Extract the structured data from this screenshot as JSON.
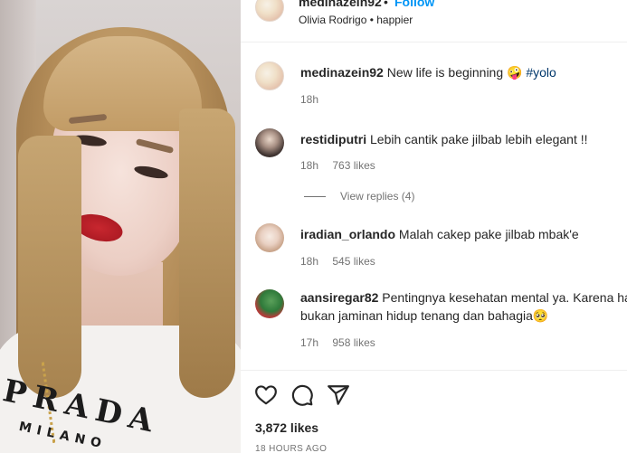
{
  "header": {
    "username": "medinazein92",
    "separator": "•",
    "follow_label": "Follow",
    "audio": "Olivia Rodrigo • happier"
  },
  "caption": {
    "username": "medinazein92",
    "text": "New life is beginning 🤪",
    "hashtag": "#yolo",
    "time": "18h"
  },
  "comments": [
    {
      "username": "restidiputri",
      "text": "Lebih cantik pake jilbab lebih elegant !!",
      "time": "18h",
      "likes": "763 likes"
    },
    {
      "username": "iradian_orlando",
      "text": "Malah cakep pake jilbab mbak'e",
      "time": "18h",
      "likes": "545 likes"
    },
    {
      "username": "aansiregar82",
      "text_line1": "Pentingnya kesehatan mental ya. Karena hart",
      "text_line2": "bukan jaminan hidup tenang dan bahagia🥺",
      "time": "17h",
      "likes": "958 likes"
    }
  ],
  "view_replies": "View replies (4)",
  "actions": {
    "icons": [
      "heart-icon",
      "comment-icon",
      "share-icon"
    ]
  },
  "likes_count": "3,872 likes",
  "timestamp": "18 HOURS AGO",
  "media": {
    "shirt_text": "PRADA",
    "shirt_sub": "MILANO"
  }
}
